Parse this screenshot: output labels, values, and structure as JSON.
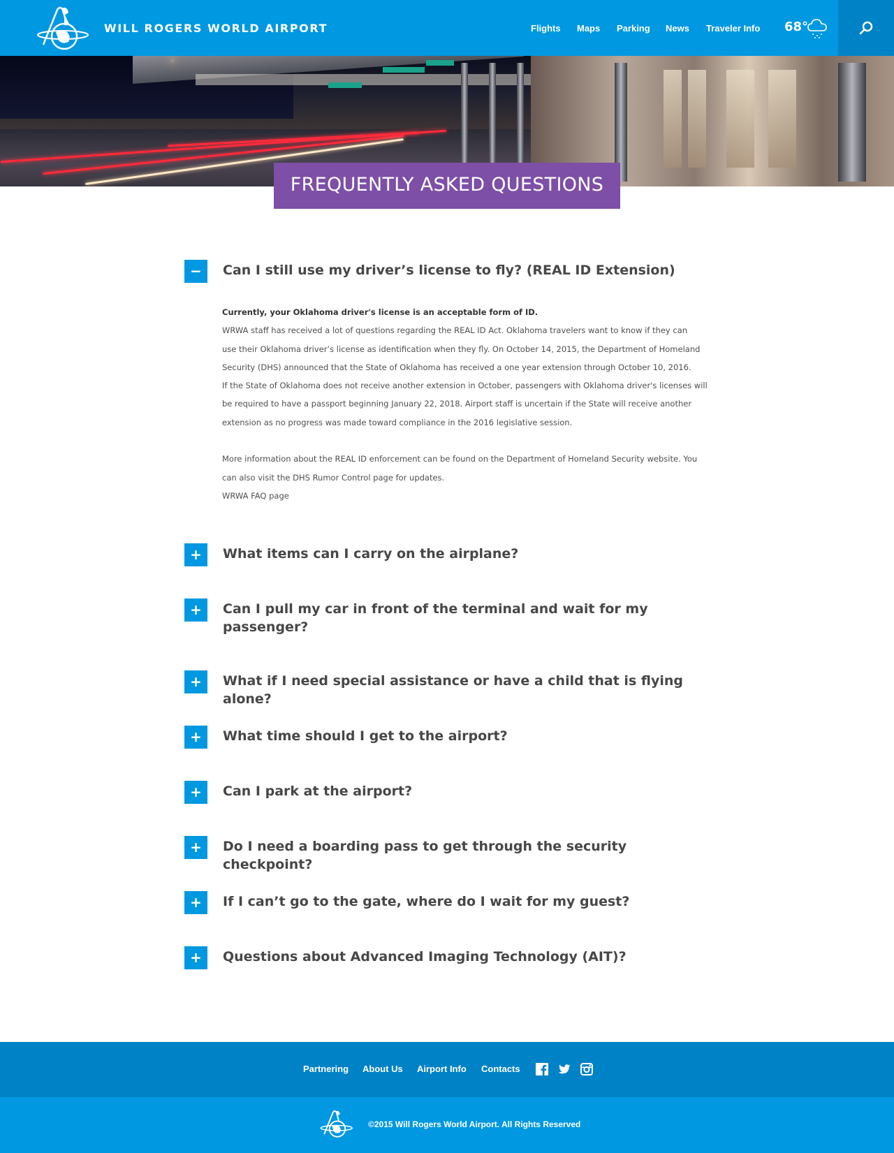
{
  "header": {
    "site_title": "WILL ROGERS WORLD AIRPORT",
    "nav": [
      {
        "label": "Flights"
      },
      {
        "label": "Maps"
      },
      {
        "label": "Parking"
      },
      {
        "label": "News"
      },
      {
        "label": "Traveler Info"
      }
    ],
    "weather": {
      "temperature": "68°",
      "icon": "cloud-rain-icon"
    },
    "search_icon": "search-icon",
    "logo_icon": "airport-logo-icon"
  },
  "hero": {
    "page_title": "FREQUENTLY ASKED QUESTIONS",
    "banner_color": "#7d4fa6"
  },
  "faq": {
    "items": [
      {
        "question": "Can I still use my driver’s license to fly? (REAL ID Extension)",
        "expanded": true,
        "toggle": "−"
      },
      {
        "question": "What items can I carry on the airplane?",
        "expanded": false,
        "toggle": "+"
      },
      {
        "question": "Can I pull my car in front of the terminal and wait for my",
        "question_line2": "passenger?",
        "expanded": false,
        "toggle": "+"
      },
      {
        "question": "What if I need special assistance or have a child that is flying alone?",
        "expanded": false,
        "toggle": "+"
      },
      {
        "question": "What time should I get to the airport?",
        "expanded": false,
        "toggle": "+"
      },
      {
        "question": "Can I park at the airport?",
        "expanded": false,
        "toggle": "+"
      },
      {
        "question": "Do I need a boarding pass to get through the security checkpoint?",
        "expanded": false,
        "toggle": "+"
      },
      {
        "question": "If I can’t go to the gate, where do I wait for my guest?",
        "expanded": false,
        "toggle": "+"
      },
      {
        "question": "Questions about Advanced Imaging Technology (AIT)?",
        "expanded": false,
        "toggle": "+"
      }
    ],
    "answer": {
      "lead": "Currently, your Oklahoma driver's license is an acceptable form of ID.",
      "lines": [
        "WRWA staff has received a lot of questions regarding the REAL ID Act.  Oklahoma travelers want to know if they can",
        "use their Oklahoma driver’s license as identification when they fly. On October 14, 2015, the Department of Homeland",
        "Security (DHS) announced that the State of Oklahoma has received a one year extension through October 10, 2016.",
        "If the State of Oklahoma does not receive another extension in October, passengers with Oklahoma driver's licenses will",
        "be required to have a passport beginning January 22, 2018. Airport staff is uncertain if the State will receive another",
        "extension as no progress was made toward compliance in the 2016 legislative session."
      ],
      "lines2": [
        "More information about the REAL ID enforcement can be found on the Department of Homeland Security website. You",
        "can also visit the DHS Rumor Control page for updates.",
        "WRWA FAQ page"
      ]
    }
  },
  "footer": {
    "links": [
      {
        "label": "Partnering"
      },
      {
        "label": "About Us"
      },
      {
        "label": "Airport Info"
      },
      {
        "label": "Contacts"
      }
    ],
    "social": [
      "facebook-icon",
      "twitter-icon",
      "instagram-icon"
    ],
    "copyright": "©2015 Will Rogers World Airport. All Rights Reserved"
  },
  "colors": {
    "primary": "#0098e0",
    "primary_dark": "#0082c6",
    "accent_purple": "#7d4fa6",
    "text": "#474747"
  }
}
